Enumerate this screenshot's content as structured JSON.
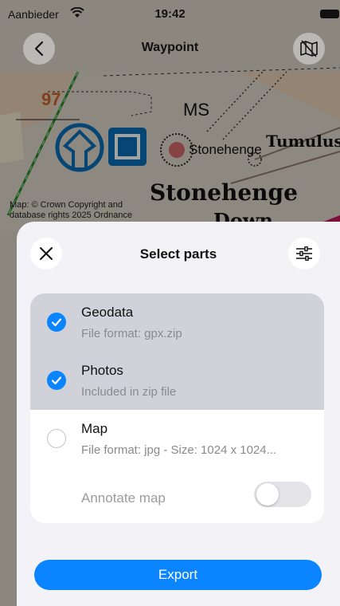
{
  "status_bar": {
    "carrier": "Aanbieder",
    "time": "19:42"
  },
  "nav": {
    "title": "Waypoint",
    "back_icon": "chevron-left-icon",
    "map_icon": "map-off-icon"
  },
  "map": {
    "labels": {
      "grid_number": "97",
      "ms": "MS",
      "tumulus": "Tumulus",
      "stonehenge_small": "Stonehenge",
      "stonehenge_large": "Stonehenge",
      "down": "Down"
    },
    "attribution_line1": "Map: © Crown Copyright and",
    "attribution_line2": "database rights 2025 Ordnance"
  },
  "sheet": {
    "title": "Select parts",
    "close_icon": "close-icon",
    "filter_icon": "sliders-icon",
    "parts": [
      {
        "title": "Geodata",
        "subtitle": "File format: gpx.zip",
        "selected": true
      },
      {
        "title": "Photos",
        "subtitle": "Included in zip file",
        "selected": true
      },
      {
        "title": "Map",
        "subtitle": "File format: jpg - Size: 1024 x 1024...",
        "selected": false
      }
    ],
    "annotate_label": "Annotate map",
    "annotate_on": false,
    "export_label": "Export"
  },
  "colors": {
    "accent": "#0a84ff",
    "selected_row": "#d1d1d9",
    "map_dim": "rgba(0,0,0,0.36)"
  }
}
